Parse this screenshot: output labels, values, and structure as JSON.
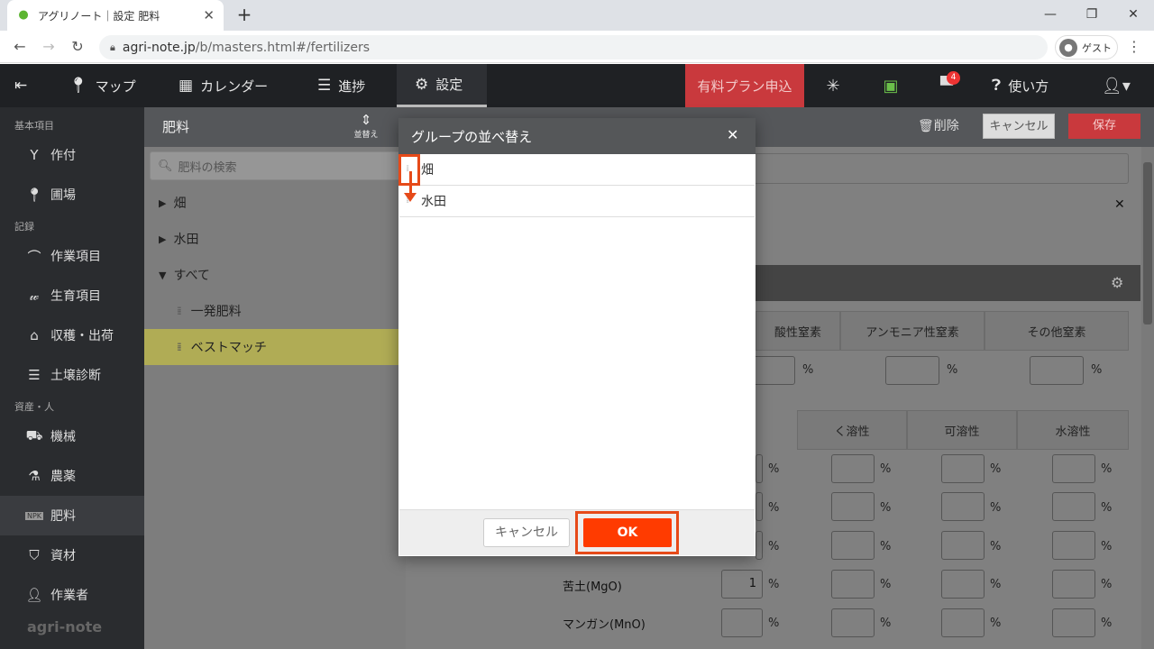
{
  "browser": {
    "tab_title": "アグリノート｜設定 肥料",
    "url_host": "agri-note.jp",
    "url_path": "/b/masters.html#/fertilizers",
    "profile_label": "ゲスト"
  },
  "appnav": {
    "map": "マップ",
    "calendar": "カレンダー",
    "progress": "進捗",
    "settings": "設定",
    "paid_plan": "有料プラン申込",
    "notification_count": "4",
    "help": "使い方"
  },
  "sidebar": {
    "section_basic": "基本項目",
    "crop": "作付",
    "field": "圃場",
    "section_record": "記録",
    "work_items": "作業項目",
    "growth_items": "生育項目",
    "harvest": "収穫・出荷",
    "soil": "土壌診断",
    "section_assets": "資産・人",
    "machines": "機械",
    "pesticides": "農薬",
    "fertilizers": "肥料",
    "materials": "資材",
    "workers": "作業者",
    "logo": "agri-note"
  },
  "main": {
    "title": "肥料",
    "sort_label": "並替え",
    "delete": "削除",
    "cancel": "キャンセル",
    "save": "保存",
    "search_placeholder": "肥料の検索",
    "tree": {
      "group1": "畑",
      "group2": "水田",
      "all": "すべて",
      "item1": "一発肥料",
      "item2": "ベストマッチ"
    },
    "nitrogen_headers": [
      "酸性窒素",
      "アンモニア性窒素",
      "その他窒素"
    ],
    "solubility_headers": [
      "く溶性",
      "可溶性",
      "水溶性"
    ],
    "unit": "%",
    "rows": [
      {
        "label": "苦土(MgO)",
        "value": "1"
      },
      {
        "label": "マンガン(MnO)",
        "value": ""
      }
    ]
  },
  "modal": {
    "title": "グループの並べ替え",
    "items": [
      "畑",
      "水田"
    ],
    "cancel": "キャンセル",
    "ok": "OK"
  }
}
